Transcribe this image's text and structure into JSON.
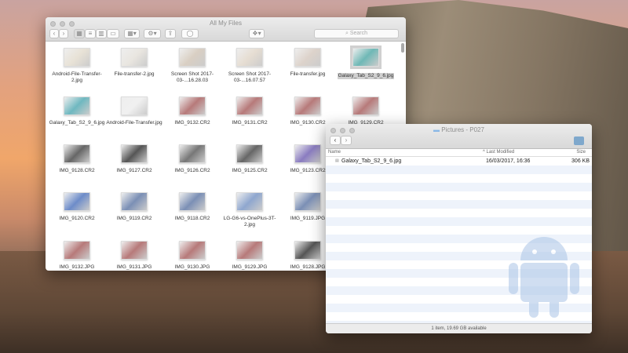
{
  "finder1": {
    "title": "All My Files",
    "search_placeholder": "Search",
    "files": [
      {
        "name": "Android-File-Transfer-2.jpg",
        "c": "#e8e2d6"
      },
      {
        "name": "File-transfer-2.jpg",
        "c": "#e9e6e0"
      },
      {
        "name": "Screen Shot 2017-03-...16.28.03",
        "c": "#d9cfc3"
      },
      {
        "name": "Screen Shot 2017-03-...16.07.57",
        "c": "#e6ddd2"
      },
      {
        "name": "File-transfer.jpg",
        "c": "#ddd3cb"
      },
      {
        "name": "Galaxy_Tab_S2_9_6.jpg",
        "c": "#6fb8b6",
        "selected": true
      },
      {
        "name": "Galaxy_Tab_S2_9_6.jpg",
        "c": "#6fb8c0"
      },
      {
        "name": "Android-File-Transfer.jpg",
        "c": "#f0f0f0"
      },
      {
        "name": "IMG_9132.CR2",
        "c": "#b77a7a"
      },
      {
        "name": "IMG_9131.CR2",
        "c": "#b77a7a"
      },
      {
        "name": "IMG_9130.CR2",
        "c": "#b77a7a"
      },
      {
        "name": "IMG_9129.CR2",
        "c": "#b77a7a"
      },
      {
        "name": "IMG_9128.CR2",
        "c": "#666"
      },
      {
        "name": "IMG_9127.CR2",
        "c": "#555"
      },
      {
        "name": "IMG_9126.CR2",
        "c": "#777"
      },
      {
        "name": "IMG_9125.CR2",
        "c": "#666"
      },
      {
        "name": "IMG_9123.CR2",
        "c": "#8a7cc0"
      },
      {
        "name": "IMG_9120.CR2",
        "c": "#6d8cc9"
      },
      {
        "name": "IMG_9119.CR2",
        "c": "#7b8fb5"
      },
      {
        "name": "IMG_9118.CR2",
        "c": "#7b8fb5"
      },
      {
        "name": "LG-G6-vs-OnePlus-3T-2.jpg",
        "c": "#8fa7cf"
      },
      {
        "name": "IMG_9119.JPG",
        "c": "#7b8fb5"
      },
      {
        "name": "IMG_9132.JPG",
        "c": "#b77a7a"
      },
      {
        "name": "IMG_9131.JPG",
        "c": "#b77a7a"
      },
      {
        "name": "IMG_9130.JPG",
        "c": "#b77a7a"
      },
      {
        "name": "IMG_9129.JPG",
        "c": "#b77a7a"
      },
      {
        "name": "IMG_9128.JPG",
        "c": "#555"
      }
    ]
  },
  "finder2": {
    "title": "Pictures - P027",
    "columns": {
      "name": "Name",
      "modified": "Last Modified",
      "size": "Size"
    },
    "rows": [
      {
        "name": "Galaxy_Tab_S2_9_6.jpg",
        "modified": "16/03/2017, 16:36",
        "size": "306 KB"
      }
    ],
    "status": "1 item, 19.69 GB available"
  }
}
